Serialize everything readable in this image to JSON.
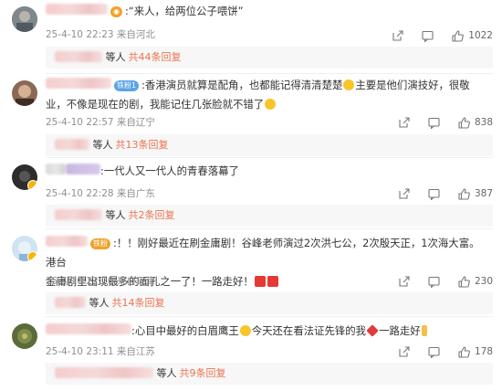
{
  "comments": [
    {
      "text": ":“来人，给两位公子喂饼”",
      "badge": "",
      "meta": "25-4-10 22:23 来自河北",
      "likes": "1022",
      "reply_prefix": "等人",
      "reply_link": "共44条回复",
      "avatar_color": "#6f7a7f"
    },
    {
      "badge": "铁粉1",
      "text_a": ":香港演员就算是配角，也都能记得清清楚楚",
      "text_b": "主要是他们演技好，很敬",
      "text_c": "业，不像是现在的剧，我能记住几张脸就不错了",
      "meta": "25-4-10 22:57 来自辽宁",
      "likes": "838",
      "reply_prefix": "等人",
      "reply_link": "共13条回复",
      "avatar_color": "#8a6a55"
    },
    {
      "text": ":一代人又一代人的青春落幕了",
      "meta": "25-4-10 22:28 来自广东",
      "likes": "387",
      "reply_prefix": "等人",
      "reply_link": "共2条回复",
      "avatar_color": "#3b3b3b"
    },
    {
      "badge": "铁粉",
      "text_a": ":！！刚好最近在刷金庸剧！谷峰老师演过2次洪七公，2次殷天正，1次海大富。港台",
      "text_b": "金庸剧里出现最多的面孔之一了！一路走好！",
      "meta": "25-4-10 22:20 来自天津",
      "likes": "230",
      "reply_prefix": "等人",
      "reply_link": "共14条回复",
      "avatar_color": "#cfe3f2"
    },
    {
      "text_a": ":心目中最好的白眉鹰王",
      "text_b": "今天还在看法证先锋的我",
      "text_c": "一路走好",
      "meta": "25-4-10 23:11 来自江苏",
      "likes": "178",
      "reply_prefix": "等人",
      "reply_link": "共9条回复",
      "avatar_color": "#5c6b3a"
    }
  ]
}
